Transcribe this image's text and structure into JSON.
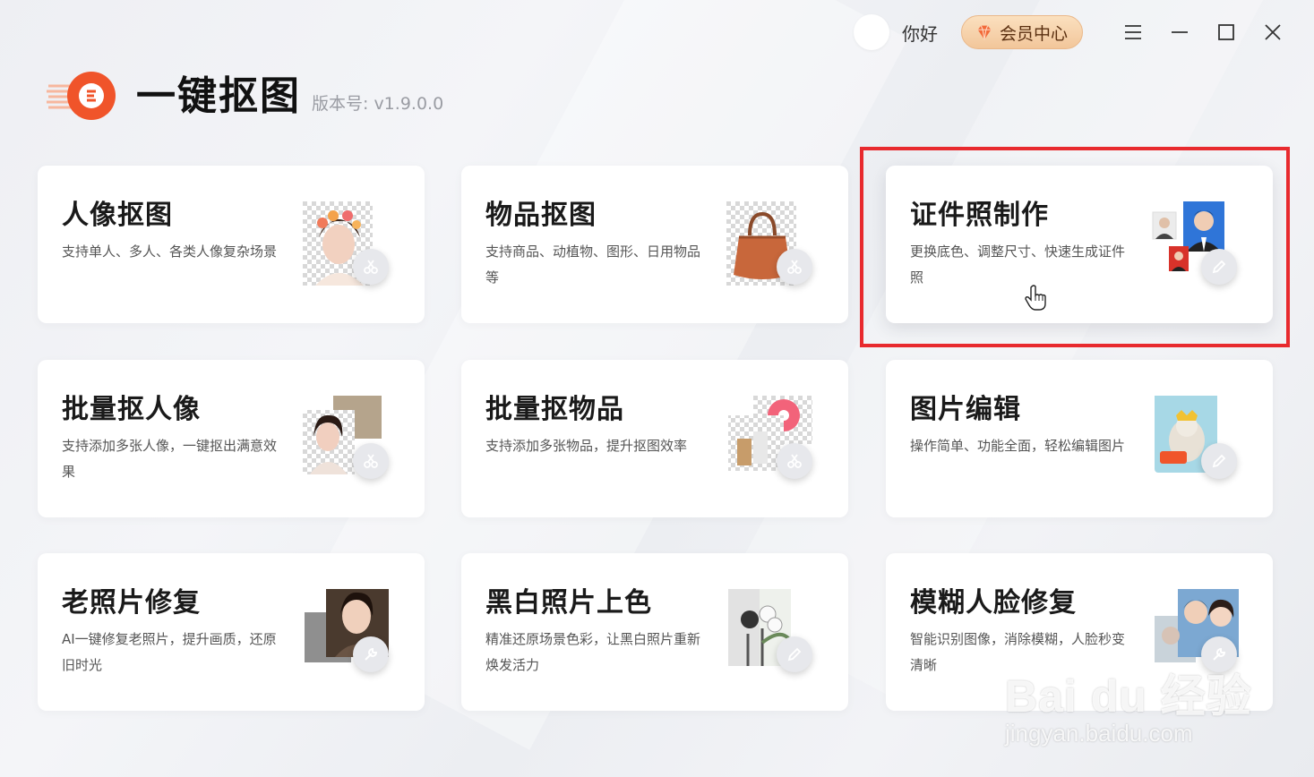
{
  "app": {
    "title": "一键抠图",
    "version": "版本号: v1.9.0.0"
  },
  "topbar": {
    "greeting": "你好",
    "vip_label": "会员中心"
  },
  "cards": [
    {
      "title": "人像抠图",
      "desc": "支持单人、多人、各类人像复杂场景"
    },
    {
      "title": "物品抠图",
      "desc": "支持商品、动植物、图形、日用物品等"
    },
    {
      "title": "证件照制作",
      "desc": "更换底色、调整尺寸、快速生成证件照"
    },
    {
      "title": "批量抠人像",
      "desc": "支持添加多张人像，一键抠出满意效果"
    },
    {
      "title": "批量抠物品",
      "desc": "支持添加多张物品，提升抠图效率"
    },
    {
      "title": "图片编辑",
      "desc": "操作简单、功能全面，轻松编辑图片"
    },
    {
      "title": "老照片修复",
      "desc": "AI一键修复老照片，提升画质，还原旧时光"
    },
    {
      "title": "黑白照片上色",
      "desc": "精准还原场景色彩，让黑白照片重新焕发活力"
    },
    {
      "title": "模糊人脸修复",
      "desc": "智能识别图像，消除模糊，人脸秒变清晰"
    }
  ],
  "watermark": {
    "main": "Bai du 经验",
    "sub": "jingyan.baidu.com"
  },
  "colors": {
    "highlight": "#e82a2e",
    "logo_orange": "#f0542a",
    "vip_gold": "#f2c69a"
  },
  "icons": {
    "cutout_badge": "scissors-icon",
    "edit_badge": "pencil-icon",
    "repair_badge": "wrench-icon"
  }
}
